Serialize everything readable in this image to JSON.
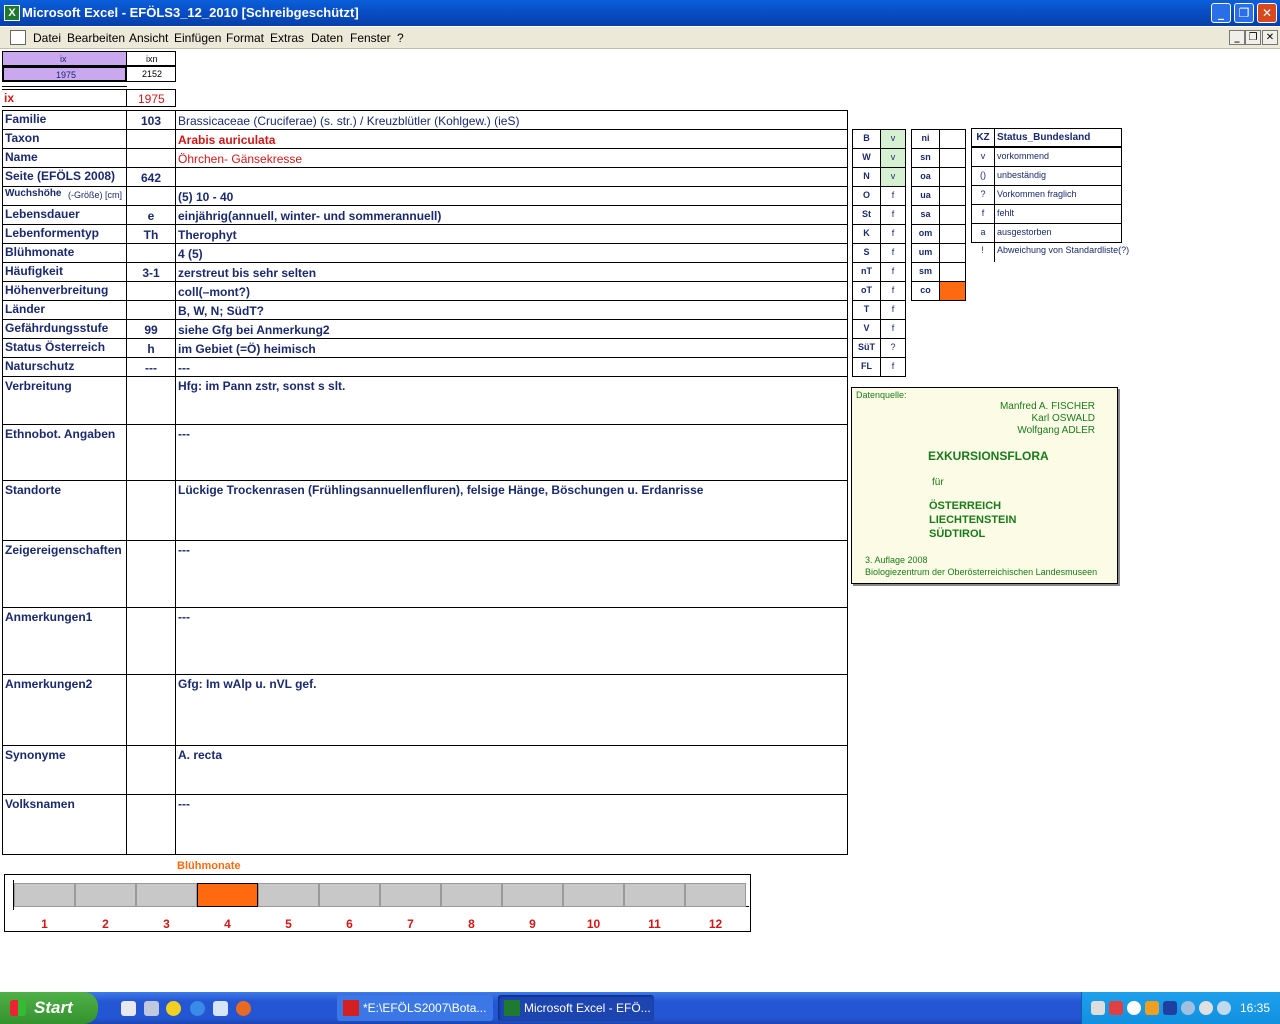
{
  "window": {
    "title": "Microsoft Excel - EFÖLS3_12_2010  [Schreibgeschützt]"
  },
  "menu": [
    "Datei",
    "Bearbeiten",
    "Ansicht",
    "Einfügen",
    "Format",
    "Extras",
    "Daten",
    "Fenster",
    "?"
  ],
  "top_cells": {
    "ix_header": "ix",
    "ixn_header": "ixn",
    "ix_value": "1975",
    "ixn_value": "2152",
    "ix_label": "ix",
    "ix_value_red": "1975"
  },
  "fields": [
    {
      "label": "Familie",
      "code": "103",
      "value": "Brassicaceae (Cruciferae) (s. str.)  /  Kreuzblütler (Kohlgew.) (ieS)"
    },
    {
      "label": "Taxon",
      "code": "",
      "value": "Arabis auriculata"
    },
    {
      "label": "Name",
      "code": "",
      "value": "Öhrchen- Gänsekresse"
    },
    {
      "label": "Seite (EFÖLS 2008)",
      "code": "642",
      "value": ""
    },
    {
      "label": "Wuchshöhe",
      "label_suffix": "(-Größe) [cm]",
      "code": "",
      "value": " (5) 10 - 40"
    },
    {
      "label": "Lebensdauer",
      "code": "e",
      "value": "einjährig(annuell, winter- und sommerannuell)"
    },
    {
      "label": "Lebenformentyp",
      "code": "Th",
      "value": "Therophyt"
    },
    {
      "label": "Blühmonate",
      "code": "",
      "value": " 4 (5)"
    },
    {
      "label": "Häufigkeit",
      "code": "3-1",
      "value": "zerstreut bis sehr selten"
    },
    {
      "label": "Höhenverbreitung",
      "code": "",
      "value": "coll(–mont?)"
    },
    {
      "label": "Länder",
      "code": "",
      "value": "B, W, N; SüdT?"
    },
    {
      "label": "Gefährdungsstufe",
      "code": "99",
      "value": "siehe Gfg bei Anmerkung2"
    },
    {
      "label": "Status Österreich",
      "code": "h",
      "value": "im Gebiet (=Ö) heimisch"
    },
    {
      "label": "Naturschutz",
      "code": "---",
      "value": "---"
    }
  ],
  "big_fields": [
    {
      "label": "Verbreitung",
      "value": "Hfg: im Pann zstr, sonst s slt."
    },
    {
      "label": "Ethnobot. Angaben",
      "value": "---"
    },
    {
      "label": "Standorte",
      "value": "Lückige Trockenrasen (Frühlingsannuellenfluren), felsige Hänge, Böschungen u. Erdanrisse"
    },
    {
      "label": "Zeigereigenschaften",
      "value": "---"
    },
    {
      "label": "Anmerkungen1",
      "value": "---"
    },
    {
      "label": "Anmerkungen2",
      "value": "Gfg:  Im wAlp u. nVL gef."
    },
    {
      "label": "Synonyme",
      "value": "A. recta"
    },
    {
      "label": "Volksnamen",
      "value": "---"
    }
  ],
  "laender": [
    {
      "kz": "B",
      "st": "v",
      "green": true
    },
    {
      "kz": "W",
      "st": "v",
      "green": true
    },
    {
      "kz": "N",
      "st": "v",
      "green": true
    },
    {
      "kz": "O",
      "st": "f"
    },
    {
      "kz": "St",
      "st": "f"
    },
    {
      "kz": "K",
      "st": "f"
    },
    {
      "kz": "S",
      "st": "f"
    },
    {
      "kz": "nT",
      "st": "f"
    },
    {
      "kz": "oT",
      "st": "f"
    },
    {
      "kz": "T",
      "st": "f"
    },
    {
      "kz": "V",
      "st": "f"
    },
    {
      "kz": "SüT",
      "st": "?"
    },
    {
      "kz": "FL",
      "st": "f"
    }
  ],
  "hoehen": [
    {
      "kz": "ni",
      "st": ""
    },
    {
      "kz": "sn",
      "st": ""
    },
    {
      "kz": "oa",
      "st": ""
    },
    {
      "kz": "ua",
      "st": ""
    },
    {
      "kz": "sa",
      "st": ""
    },
    {
      "kz": "om",
      "st": ""
    },
    {
      "kz": "um",
      "st": ""
    },
    {
      "kz": "sm",
      "st": ""
    },
    {
      "kz": "co",
      "st": "",
      "orange": true
    }
  ],
  "legend": {
    "kz_header": "KZ",
    "status_header": "Status_Bundesland",
    "rows": [
      {
        "kz": "v",
        "text": "vorkommend"
      },
      {
        "kz": "()",
        "text": "unbeständig"
      },
      {
        "kz": "?",
        "text": "Vorkommen fraglich"
      },
      {
        "kz": "f",
        "text": "fehlt"
      },
      {
        "kz": "a",
        "text": "ausgestorben"
      },
      {
        "kz": "!",
        "text": "Abweichung von Standardliste(?)"
      }
    ]
  },
  "source": {
    "label": "Datenquelle:",
    "authors": [
      "Manfred A. FISCHER",
      "Karl OSWALD",
      "Wolfgang ADLER"
    ],
    "title": "EXKURSIONSFLORA",
    "fuer": "für",
    "countries": [
      "ÖSTERREICH",
      "LIECHTENSTEIN",
      "SÜDTIROL"
    ],
    "edition": "3. Auflage 2008",
    "publisher": "Biologiezentrum der Oberösterreichischen Landesmuseen"
  },
  "bloom": {
    "title": "Blühmonate",
    "months": [
      "1",
      "2",
      "3",
      "4",
      "5",
      "6",
      "7",
      "8",
      "9",
      "10",
      "11",
      "12"
    ],
    "active_months": [
      4
    ],
    "active_color": "#ff6a10",
    "inactive_color": "#c8c8c8"
  },
  "taskbar": {
    "start_label": "Start",
    "tasks": [
      "*E:\\EFÖLS2007\\Bota...",
      "Microsoft Excel - EFÖ..."
    ],
    "clock": "16:35"
  }
}
